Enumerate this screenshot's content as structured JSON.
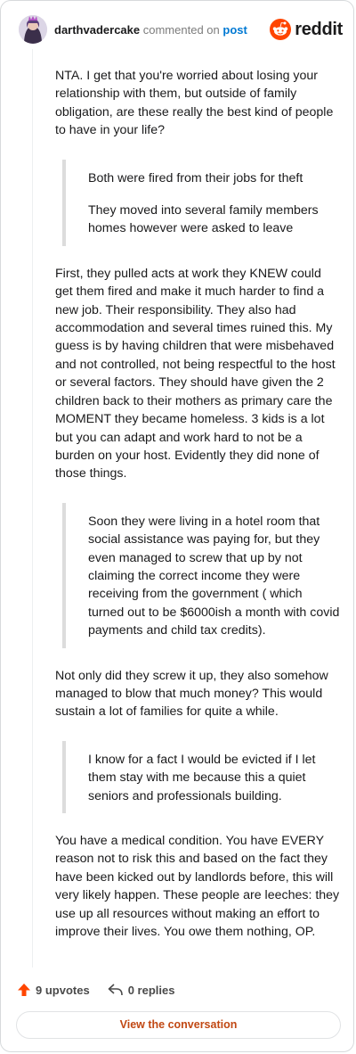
{
  "header": {
    "username": "darthvadercake",
    "action": "commented on",
    "post_link": "post",
    "brand": "reddit"
  },
  "comment": {
    "paragraphs": [
      "NTA. I get that you're worried about losing your relationship with them, but outside of family obligation, are these really the best kind of people to have in your life?",
      "First, they pulled acts at work they KNEW could get them fired and make it much harder to find a new job. Their responsibility. They also had accommodation and several times ruined this. My guess is by having children that were misbehaved and not controlled, not being respectful to the host or several factors. They should have given the 2 children back to their mothers as primary care the MOMENT they became homeless. 3 kids is a lot but you can adapt and work hard to not be a burden on your host. Evidently they did none of those things.",
      "Not only did they screw it up, they also somehow managed to blow that much money? This would sustain a lot of families for quite a while.",
      "You have a medical condition. You have EVERY reason not to risk this and based on the fact they have been kicked out by landlords before, this will very likely happen. These people are leeches: they use up all resources without making an effort to improve their lives. You owe them nothing, OP."
    ],
    "quotes": [
      [
        "Both were fired from their jobs for theft",
        "They moved into several family members homes however were asked to leave"
      ],
      [
        "Soon they were living in a hotel room that social assistance was paying for, but they even managed to screw that up by not claiming the correct income they were receiving from the government ( which turned out to be $6000ish a month with covid payments and child tax credits)."
      ],
      [
        "I know for a fact I would be evicted if I let them stay with me because this a quiet seniors and professionals building."
      ]
    ]
  },
  "footer": {
    "upvotes": "9 upvotes",
    "replies": "0 replies",
    "conversation_button": "View the conversation"
  },
  "colors": {
    "upvote_arrow": "#ff4500",
    "brand_orange": "#ff4500",
    "link_blue": "#0079d3",
    "button_text": "#c14813"
  }
}
